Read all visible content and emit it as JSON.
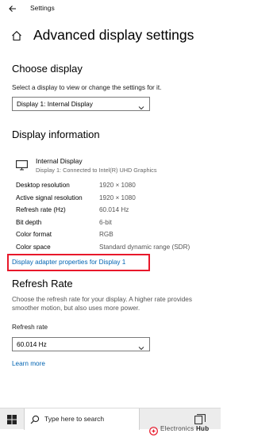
{
  "window": {
    "title": "Settings"
  },
  "page": {
    "title": "Advanced display settings"
  },
  "choose_display": {
    "heading": "Choose display",
    "description": "Select a display to view or change the settings for it.",
    "selected": "Display 1: Internal Display"
  },
  "display_info": {
    "heading": "Display information",
    "display_name": "Internal Display",
    "display_connection": "Display 1: Connected to Intel(R) UHD Graphics",
    "rows": [
      {
        "label": "Desktop resolution",
        "value": "1920 × 1080"
      },
      {
        "label": "Active signal resolution",
        "value": "1920 × 1080"
      },
      {
        "label": "Refresh rate (Hz)",
        "value": "60.014 Hz"
      },
      {
        "label": "Bit depth",
        "value": "6-bit"
      },
      {
        "label": "Color format",
        "value": "RGB"
      },
      {
        "label": "Color space",
        "value": "Standard dynamic range (SDR)"
      }
    ],
    "adapter_link": "Display adapter properties for Display 1"
  },
  "refresh_rate": {
    "heading": "Refresh Rate",
    "description_line1": "Choose the refresh rate for your display. A higher rate provides",
    "description_line2": "smoother motion, but also uses more power.",
    "field_label": "Refresh rate",
    "selected": "60.014 Hz",
    "learn_more": "Learn more"
  },
  "taskbar": {
    "search_placeholder": "Type here to search"
  },
  "watermark": {
    "brand": "Electronics",
    "brand_bold": "Hub"
  },
  "colors": {
    "accent_link": "#0063b1",
    "highlight": "#e8182a"
  }
}
